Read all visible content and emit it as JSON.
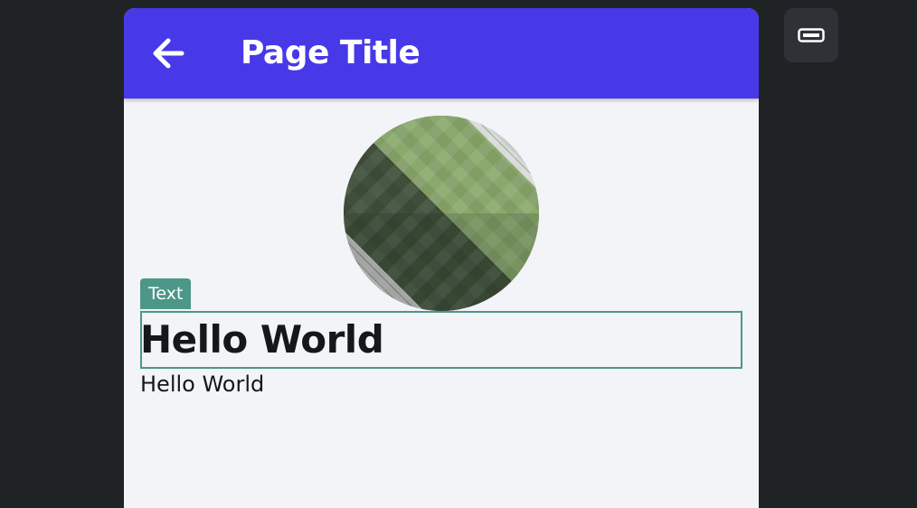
{
  "appbar": {
    "title": "Page Title",
    "back_icon": "arrow-left-icon",
    "color": "#4739e8"
  },
  "avatar": {
    "icon": "stadium-aerial-image"
  },
  "selection": {
    "tag_label": "Text",
    "color": "#4c9787"
  },
  "content": {
    "heading": "Hello World",
    "body": "Hello World"
  },
  "side_toolbar": {
    "icon": "device-preview-icon"
  }
}
